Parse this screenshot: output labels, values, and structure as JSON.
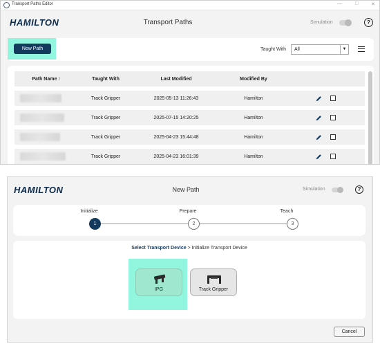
{
  "window1": {
    "titlebar": {
      "title": "Transport Paths Editor"
    },
    "header": {
      "logo_main": "HAMILTON",
      "title": "Transport Paths",
      "simulation_label": "Simulation",
      "simulation_on": false,
      "help_glyph": "?"
    },
    "toolbar": {
      "new_path_label": "New Path",
      "taught_with_label": "Taught With",
      "taught_with_value": "All",
      "menu_icon": "hamburger-icon"
    },
    "table": {
      "columns": [
        "Path Name ↑",
        "Taught With",
        "Last Modified",
        "Modified By"
      ],
      "rows": [
        {
          "path_name": "",
          "taught_with": "Track Gripper",
          "last_modified": "2025-05-13 11:26:43",
          "modified_by": "Hamilton"
        },
        {
          "path_name": "",
          "taught_with": "Track Gripper",
          "last_modified": "2025-07-15 14:20:25",
          "modified_by": "Hamilton"
        },
        {
          "path_name": "",
          "taught_with": "Track Gripper",
          "last_modified": "2025-04-23 15:44:48",
          "modified_by": "Hamilton"
        },
        {
          "path_name": "",
          "taught_with": "Track Gripper",
          "last_modified": "2025-04-23 16:01:39",
          "modified_by": "Hamilton"
        }
      ]
    }
  },
  "window2": {
    "header": {
      "logo_main": "HAMILTON",
      "title": "New Path",
      "simulation_label": "Simulation",
      "simulation_on": false,
      "help_glyph": "?"
    },
    "steps": [
      {
        "label": "Initialize",
        "number": "1",
        "active": true
      },
      {
        "label": "Prepare",
        "number": "2",
        "active": false
      },
      {
        "label": "Teach",
        "number": "3",
        "active": false
      }
    ],
    "breadcrumb": {
      "current": "Select Transport Device",
      "separator": " > ",
      "next": "Initialize Transport Device"
    },
    "devices": [
      {
        "label": "IPG",
        "selected": true,
        "icon": "ipg-gripper-icon"
      },
      {
        "label": "Track Gripper",
        "selected": false,
        "icon": "track-gripper-icon"
      }
    ],
    "cancel_label": "Cancel"
  },
  "colors": {
    "brand_navy": "#143a5e",
    "highlight": "#7ff5d8",
    "selected_device": "#9fe8cf",
    "background": "#f3f3f3"
  }
}
